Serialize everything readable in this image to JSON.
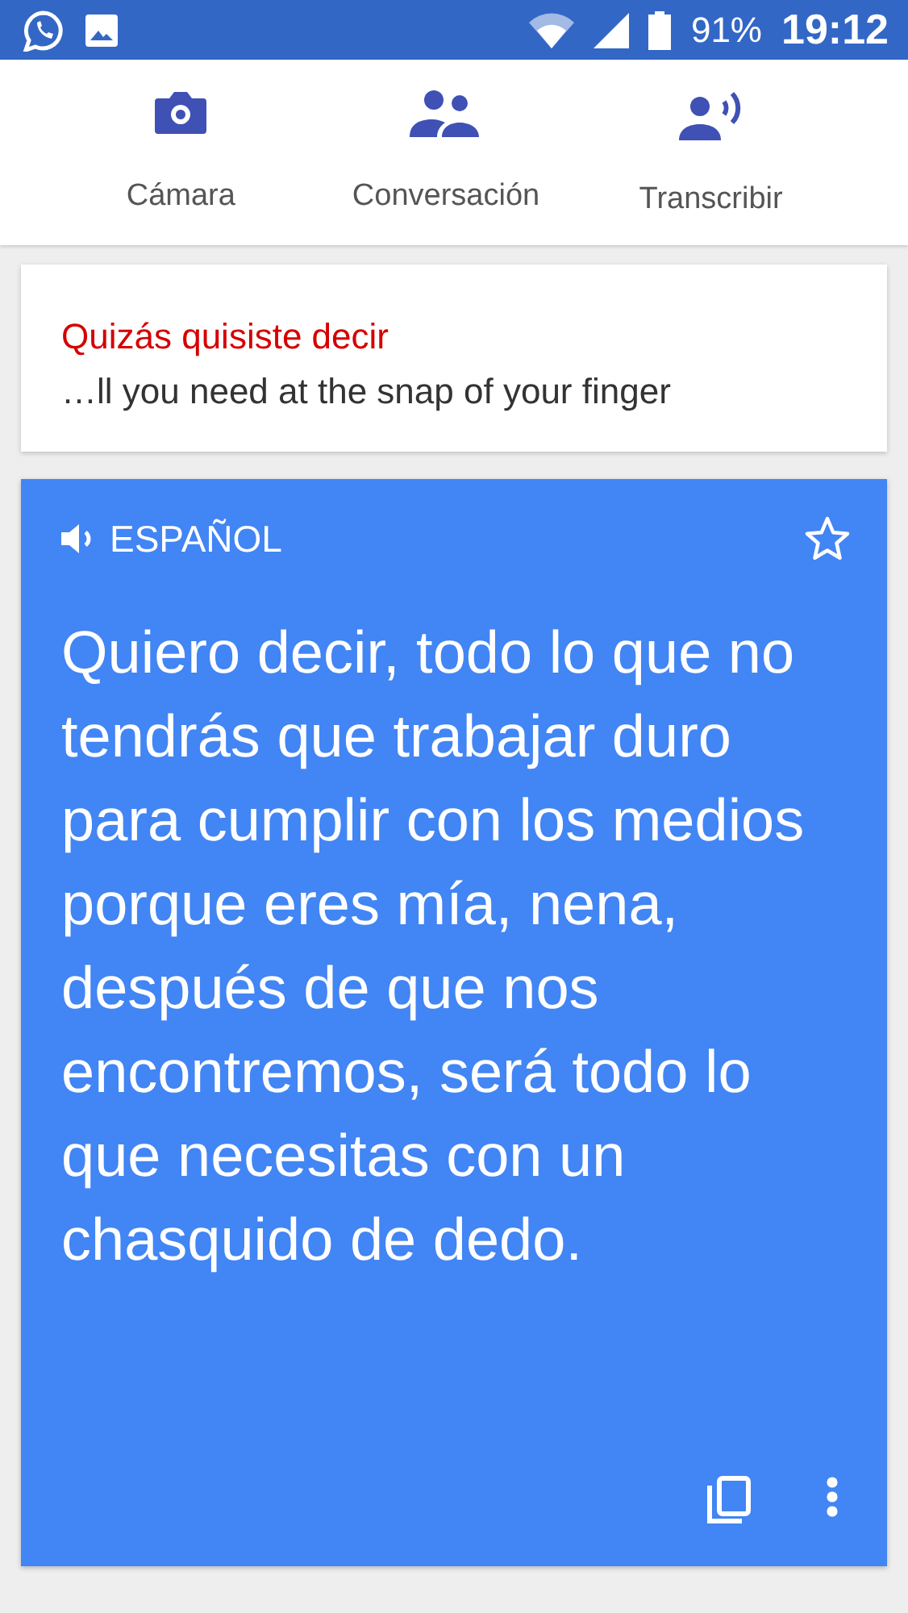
{
  "status_bar": {
    "battery": "91%",
    "time": "19:12"
  },
  "tabs": [
    {
      "label": "Cámara",
      "kind": "camera"
    },
    {
      "label": "Conversación",
      "kind": "conversation"
    },
    {
      "label": "Transcribir",
      "kind": "transcribe"
    }
  ],
  "suggestion": {
    "title": "Quizás quisiste decir",
    "text": "…ll you need at the snap of your finger"
  },
  "translation": {
    "language": "ESPAÑOL",
    "starred": false,
    "text": "Quiero decir, todo lo que no tendrás que trabajar duro para cumplir con los medios porque eres mía, nena, después de que nos encontremos, será todo lo que necesitas con un chasquido de dedo."
  }
}
